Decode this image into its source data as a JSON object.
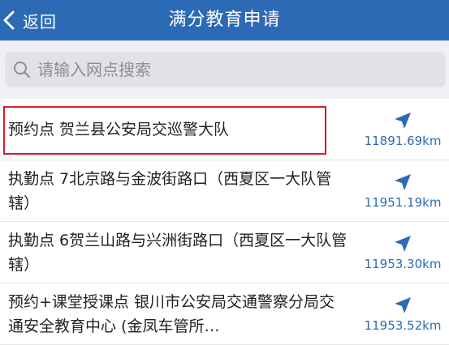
{
  "header": {
    "back_label": "返回",
    "title": "满分教育申请"
  },
  "search": {
    "placeholder": "请输入网点搜索",
    "value": ""
  },
  "items": [
    {
      "name": "预约点 贺兰县公安局交巡警大队",
      "distance": "11891.69km"
    },
    {
      "name": "执勤点 7北京路与金波街路口（西夏区一大队管辖）",
      "distance": "11951.19km"
    },
    {
      "name": "执勤点 6贺兰山路与兴洲街路口（西夏区一大队管辖）",
      "distance": "11953.30km"
    },
    {
      "name": "预约+课堂授课点 银川市公安局交通警察分局交通安全教育中心 (金凤车管所…",
      "distance": "11953.52km"
    }
  ],
  "colors": {
    "header_bg": "#2d6ab5",
    "accent": "#2d6ab5",
    "highlight": "#d0202a"
  },
  "icons": {
    "back": "chevron-left-icon",
    "search": "search-icon",
    "navigate": "navigation-arrow-icon"
  }
}
